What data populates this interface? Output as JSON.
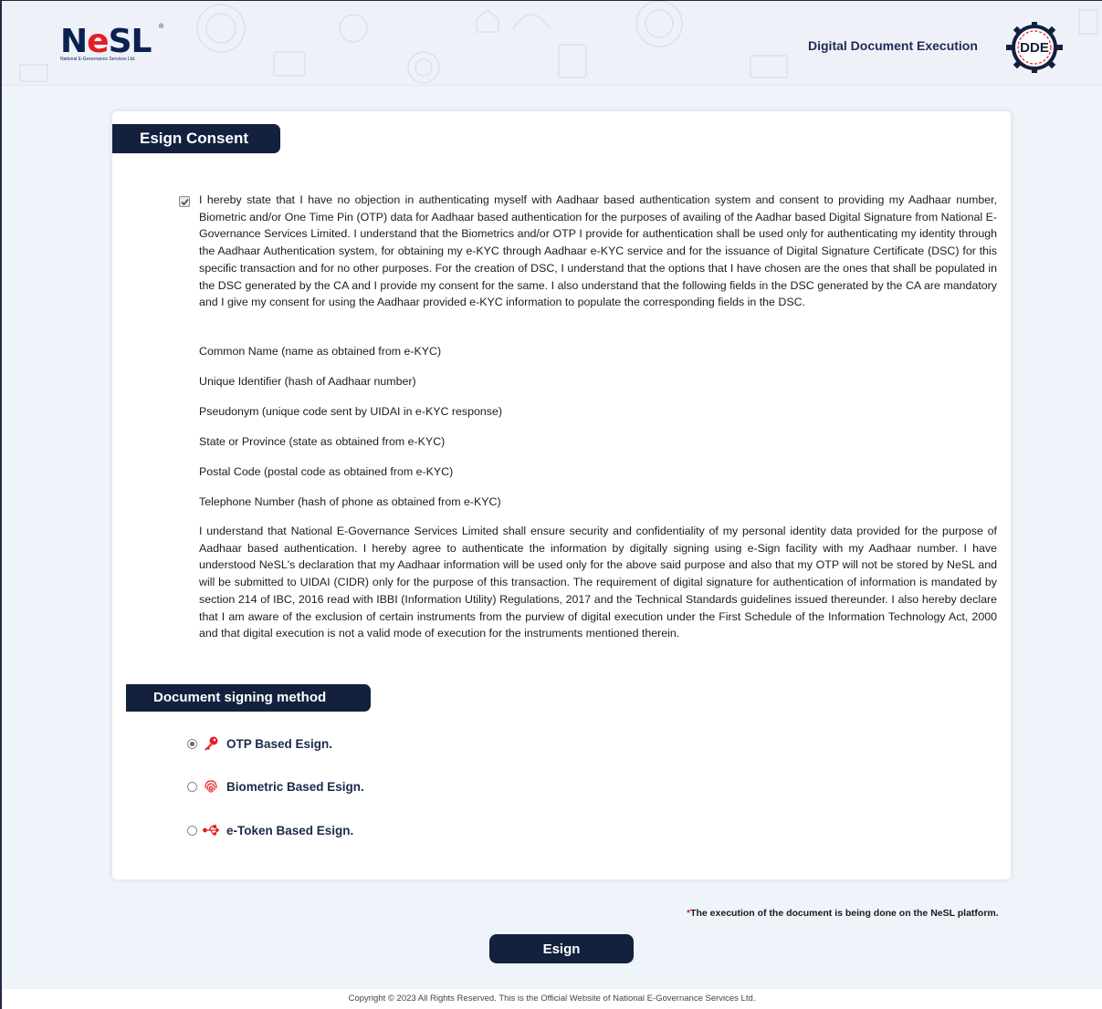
{
  "header": {
    "logo_text_prefix": "N",
    "logo_text_accent": "e",
    "logo_text_suffix": "SL",
    "logo_reg": "®",
    "logo_subtitle": "National E-Governance Services Ltd.",
    "app_title": "Digital Document Execution",
    "dde_badge": "DDE"
  },
  "consent": {
    "section_title": "Esign Consent",
    "checked": true,
    "paragraph1": "I hereby state that I have no objection in authenticating myself with Aadhaar based authentication system and consent to providing my Aadhaar number, Biometric and/or One Time Pin (OTP) data for Aadhaar based authentication for the purposes of availing of the Aadhar based Digital Signature from National E-Governance Services Limited. I understand that the Biometrics and/or OTP I provide for authentication shall be used only for authenticating my identity through the Aadhaar Authentication system, for obtaining my e-KYC through Aadhaar e-KYC service and for the issuance of Digital Signature Certificate (DSC) for this specific transaction and for no other purposes. For the creation of DSC, I understand that the options that I have chosen are the ones that shall be populated in the DSC generated by the CA and I provide my consent for the same. I also understand that the following fields in the DSC generated by the CA are mandatory and I give my consent for using the Aadhaar provided e-KYC information to populate the corresponding fields in the DSC.",
    "fields": [
      "Common Name (name as obtained from e-KYC)",
      "Unique Identifier (hash of Aadhaar number)",
      "Pseudonym (unique code sent by UIDAI in e-KYC response)",
      "State or Province (state as obtained from e-KYC)",
      "Postal Code (postal code as obtained from e-KYC)",
      "Telephone Number (hash of phone as obtained from e-KYC)"
    ],
    "paragraph2": "I understand that National E-Governance Services Limited shall ensure security and confidentiality of my personal identity data provided for the purpose of Aadhaar based authentication. I hereby agree to authenticate the information by digitally signing using e-Sign facility with my Aadhaar number. I have understood NeSL's declaration that my Aadhaar information will be used only for the above said purpose and also that my OTP will not be stored by NeSL and will be submitted to UIDAI (CIDR) only for the purpose of this transaction. The requirement of digital signature for authentication of information is mandated by section 214 of IBC, 2016 read with IBBI (Information Utility) Regulations, 2017 and the Technical Standards guidelines issued thereunder. I also hereby declare that I am aware of the exclusion of certain instruments from the purview of digital execution under the First Schedule of the Information Technology Act, 2000 and that digital execution is not a valid mode of execution for the instruments mentioned therein."
  },
  "method": {
    "section_title": "Document signing method",
    "selected": "otp",
    "options": [
      {
        "id": "otp",
        "label": "OTP Based Esign.",
        "icon": "key-icon"
      },
      {
        "id": "biometric",
        "label": "Biometric Based Esign.",
        "icon": "fingerprint-icon"
      },
      {
        "id": "etoken",
        "label": "e-Token Based Esign.",
        "icon": "usb-icon"
      }
    ]
  },
  "note": {
    "star": "*",
    "text": "The execution of the document is being done on the NeSL platform."
  },
  "esign_button": "Esign",
  "footer": {
    "prefix": "Copyright",
    "symbol": "©",
    "text": "2023 All Rights Reserved. This is the Official Website of National E-Governance Services Ltd."
  },
  "colors": {
    "navy": "#13213f",
    "accent_red": "#e31e24",
    "page_bg": "#eff4fa"
  }
}
